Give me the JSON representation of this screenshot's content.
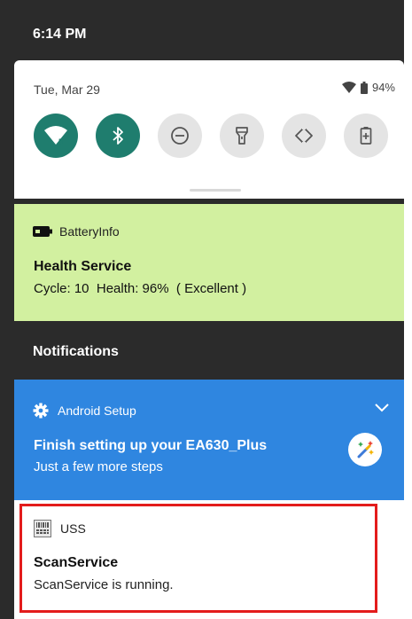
{
  "status_bar": {
    "time": "6:14 PM"
  },
  "quick_settings": {
    "date": "Tue, Mar 29",
    "battery_percent": "94%",
    "tiles": [
      {
        "icon": "wifi-icon",
        "state": "on"
      },
      {
        "icon": "bluetooth-icon",
        "state": "on"
      },
      {
        "icon": "do-not-disturb-icon",
        "state": "off"
      },
      {
        "icon": "flashlight-icon",
        "state": "off"
      },
      {
        "icon": "auto-rotate-icon",
        "state": "off"
      },
      {
        "icon": "battery-saver-icon",
        "state": "off"
      }
    ]
  },
  "battery_notification": {
    "app": "BatteryInfo",
    "title": "Health Service",
    "detail": "Cycle: 10  Health: 96%  ( Excellent )"
  },
  "notifications_heading": "Notifications",
  "setup_notification": {
    "app": "Android Setup",
    "title": "Finish setting up your EA630_Plus",
    "subtitle": "Just a few more steps"
  },
  "uss_notification": {
    "app": "USS",
    "title": "ScanService",
    "subtitle": "ScanService is running."
  },
  "colors": {
    "tile_on": "#1f7d6e",
    "tile_off": "#e4e4e4",
    "battery_card": "#d2f0a0",
    "setup_card": "#2f86e0",
    "highlight": "#e31c1c"
  }
}
